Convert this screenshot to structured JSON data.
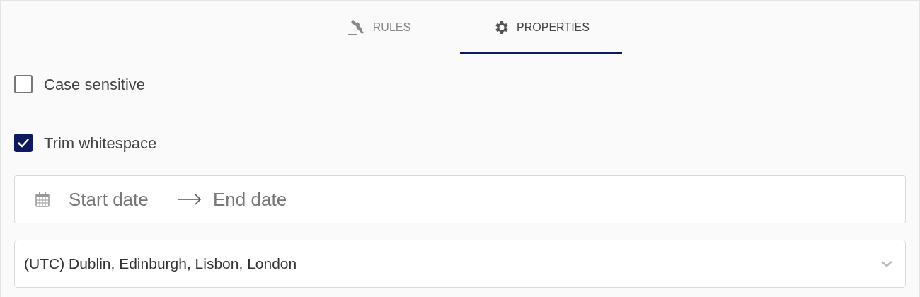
{
  "tabs": [
    {
      "label": "RULES",
      "kind": "gavel",
      "selected": false
    },
    {
      "label": "PROPERTIES",
      "kind": "gear",
      "selected": true
    }
  ],
  "options": [
    {
      "label": "Case sensitive",
      "checked": false
    },
    {
      "label": "Trim whitespace",
      "checked": true
    }
  ],
  "date_range": {
    "start_placeholder": "Start date",
    "end_placeholder": "End date"
  },
  "timezone_select": {
    "value": "(UTC) Dublin, Edinburgh, Lisbon, London"
  }
}
